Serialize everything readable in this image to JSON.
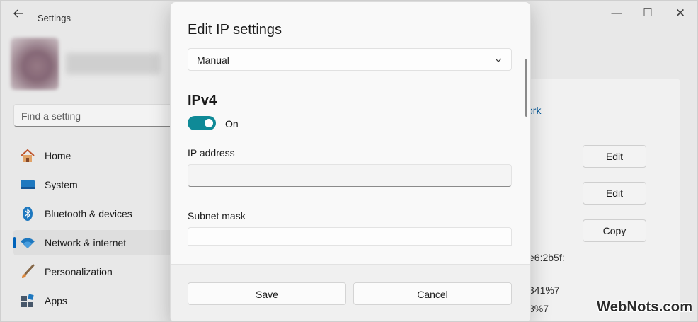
{
  "window": {
    "title": "Settings",
    "controls": {
      "minimize": "—",
      "maximize": "☐",
      "close": "✕"
    }
  },
  "search": {
    "placeholder": "Find a setting"
  },
  "sidebar": {
    "items": [
      {
        "label": "Home",
        "icon": "home-icon",
        "active": false
      },
      {
        "label": "System",
        "icon": "system-icon",
        "active": false
      },
      {
        "label": "Bluetooth & devices",
        "icon": "bluetooth-icon",
        "active": false
      },
      {
        "label": "Network & internet",
        "icon": "wifi-icon",
        "active": true
      },
      {
        "label": "Personalization",
        "icon": "brush-icon",
        "active": false
      },
      {
        "label": "Apps",
        "icon": "apps-icon",
        "active": false
      }
    ]
  },
  "background": {
    "partial_link": "ork",
    "buttons": {
      "edit1": "Edit",
      "edit2": "Edit",
      "copy": "Copy"
    },
    "fragments": {
      "f1": "e6:2b5f:",
      "f2": "341%7",
      "f3": "8%7"
    }
  },
  "dialog": {
    "title": "Edit IP settings",
    "mode_dropdown": {
      "value": "Manual"
    },
    "section": "IPv4",
    "toggle": {
      "state": "On",
      "on": true
    },
    "fields": {
      "ip_label": "IP address",
      "ip_value": "",
      "subnet_label": "Subnet mask",
      "subnet_value": ""
    },
    "buttons": {
      "save": "Save",
      "cancel": "Cancel"
    }
  },
  "watermark": "WebNots.com",
  "colors": {
    "accent": "#0f8a97",
    "nav_indicator": "#0067c0"
  }
}
